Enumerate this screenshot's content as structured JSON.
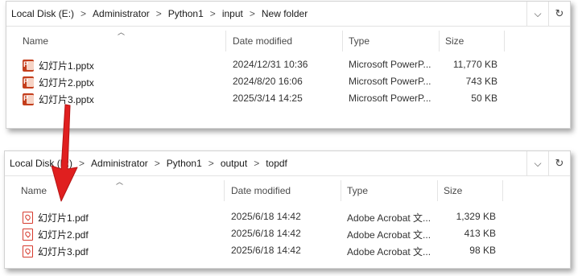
{
  "top": {
    "breadcrumb": [
      "Local Disk (E:)",
      "Administrator",
      "Python1",
      "input",
      "New folder"
    ],
    "columns": {
      "name": "Name",
      "date": "Date modified",
      "type": "Type",
      "size": "Size"
    },
    "files": [
      {
        "name": "幻灯片1.pptx",
        "date": "2024/12/31 10:36",
        "type": "Microsoft PowerP...",
        "size": "11,770 KB",
        "icon": "powerpoint-file-icon"
      },
      {
        "name": "幻灯片2.pptx",
        "date": "2024/8/20 16:06",
        "type": "Microsoft PowerP...",
        "size": "743 KB",
        "icon": "powerpoint-file-icon"
      },
      {
        "name": "幻灯片3.pptx",
        "date": "2025/3/14 14:25",
        "type": "Microsoft PowerP...",
        "size": "50 KB",
        "icon": "powerpoint-file-icon"
      }
    ]
  },
  "bottom": {
    "breadcrumb": [
      "Local Disk (E:)",
      "Administrator",
      "Python1",
      "output",
      "topdf"
    ],
    "columns": {
      "name": "Name",
      "date": "Date modified",
      "type": "Type",
      "size": "Size"
    },
    "files": [
      {
        "name": "幻灯片1.pdf",
        "date": "2025/6/18 14:42",
        "type": "Adobe Acrobat 文...",
        "size": "1,329 KB",
        "icon": "pdf-file-icon"
      },
      {
        "name": "幻灯片2.pdf",
        "date": "2025/6/18 14:42",
        "type": "Adobe Acrobat 文...",
        "size": "413 KB",
        "icon": "pdf-file-icon"
      },
      {
        "name": "幻灯片3.pdf",
        "date": "2025/6/18 14:42",
        "type": "Adobe Acrobat 文...",
        "size": "98 KB",
        "icon": "pdf-file-icon"
      }
    ]
  },
  "glyphs": {
    "sep": ">",
    "dropdown": "⌵",
    "refresh": "↻",
    "sort": "︿"
  },
  "colors": {
    "arrow": "#e01f1f",
    "ppt": "#c43e1c",
    "pdf": "#d63a2e"
  }
}
